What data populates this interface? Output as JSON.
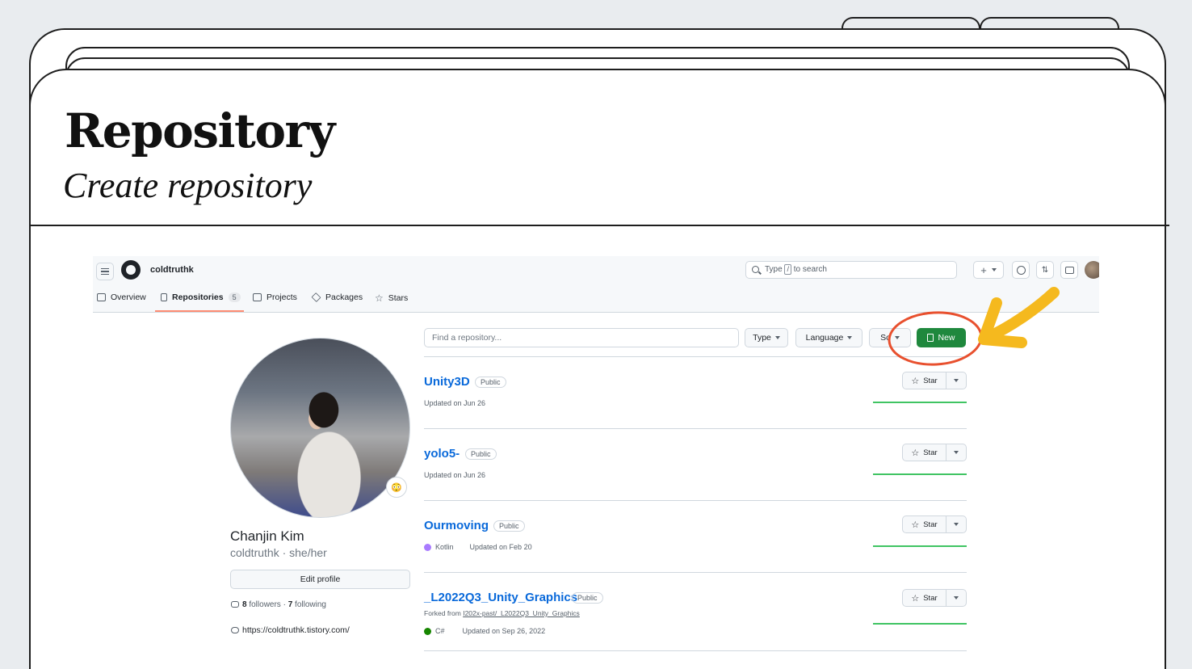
{
  "slide": {
    "title": "Repository",
    "subtitle": "Create repository"
  },
  "header": {
    "username": "coldtruthk",
    "search_before": "Type",
    "search_key": "/",
    "search_after": "to search",
    "plus_label": "+",
    "issues_icon": "issue-circle-icon",
    "pulls_icon": "pull-request-icon",
    "inbox_icon": "inbox-icon"
  },
  "tabs": [
    {
      "label": "Overview",
      "icon": "book-icon"
    },
    {
      "label": "Repositories",
      "icon": "repo-icon",
      "count": "5",
      "active": true
    },
    {
      "label": "Projects",
      "icon": "table-icon"
    },
    {
      "label": "Packages",
      "icon": "package-icon"
    },
    {
      "label": "Stars",
      "icon": "star-icon"
    }
  ],
  "profile": {
    "full_name": "Chanjin Kim",
    "login_pronouns": "coldtruthk · she/her",
    "edit_label": "Edit profile",
    "followers": "8",
    "followers_label": "followers",
    "following": "7",
    "following_label": "following",
    "website": "https://coldtruthk.tistory.com/",
    "emoji": "😳"
  },
  "filters": {
    "find_placeholder": "Find a repository...",
    "type_label": "Type",
    "language_label": "Language",
    "sort_label": "So",
    "new_label": "New"
  },
  "repos": [
    {
      "name": "Unity3D",
      "visibility": "Public",
      "updated": "Updated on Jun 26",
      "star": "Star"
    },
    {
      "name": "yolo5-",
      "visibility": "Public",
      "updated": "Updated on Jun 26",
      "star": "Star"
    },
    {
      "name": "Ourmoving",
      "visibility": "Public",
      "language": "Kotlin",
      "language_color": "#a97bff",
      "updated": "Updated on Feb 20",
      "star": "Star"
    },
    {
      "name": "_L2022Q3_Unity_Graphics",
      "visibility": "Public",
      "forked_prefix": "Forked from",
      "forked_from": "I202x-past/_L2022Q3_Unity_Graphics",
      "language": "C#",
      "language_color": "#178600",
      "updated": "Updated on Sep 26, 2022",
      "star": "Star"
    }
  ],
  "colors": {
    "accent_green": "#1f883d",
    "link_blue": "#0969da",
    "annotation_red": "#e8502e",
    "annotation_yellow": "#f5b91e"
  }
}
